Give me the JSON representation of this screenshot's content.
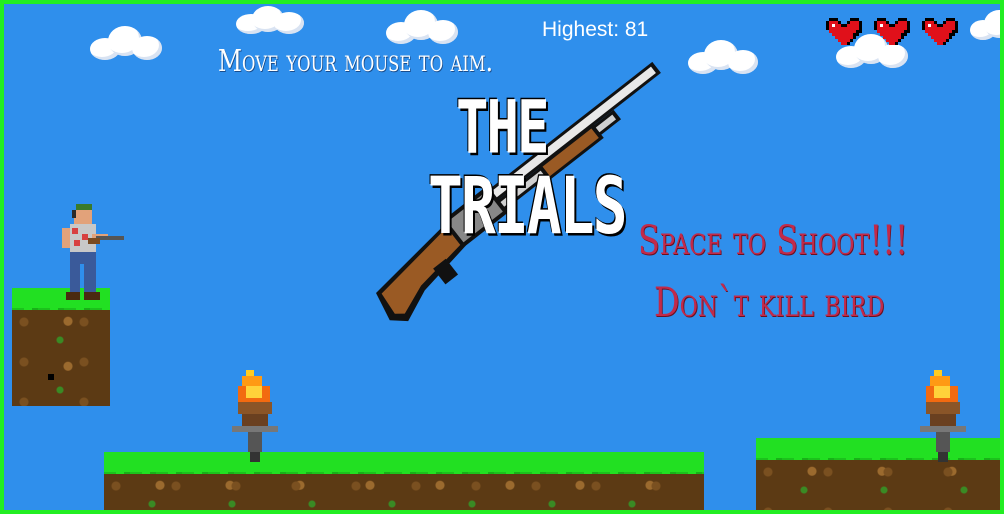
{
  "hud": {
    "highest_label": "Highest: 81",
    "lives": 3,
    "heart_color": "#e0101a"
  },
  "hints": {
    "aim": "Move your mouse to aim.",
    "shoot": "Space to Shoot!!!",
    "bird": "Don`t kill bird"
  },
  "title": {
    "line1": "THE",
    "line2": "TRIALS"
  },
  "colors": {
    "sky": "#2f8fec",
    "border": "#22ee22",
    "grass": "#22e022",
    "dirt": "#5c3a14",
    "hint_red": "#c22a4a"
  },
  "icons": [
    "heart-icon",
    "shotgun-icon",
    "torch-icon",
    "player-sprite",
    "cloud"
  ]
}
